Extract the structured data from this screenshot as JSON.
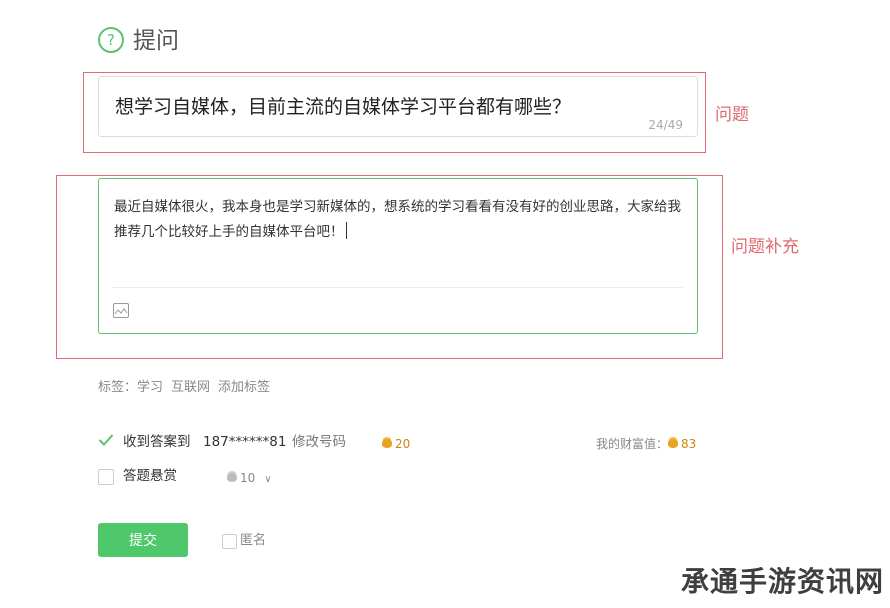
{
  "header": {
    "icon": "question-circle-icon",
    "icon_glyph": "?",
    "title": "提问"
  },
  "question": {
    "title_value": "想学习自媒体，目前主流的自媒体学习平台都有哪些？",
    "char_count": "24/49",
    "annotation": "问题"
  },
  "description": {
    "value": "最近自媒体很火，我本身也是学习新媒体的，想系统的学习看看有没有好的创业思路，大家给我推荐几个比较好上手的自媒体平台吧！",
    "annotation": "问题补充",
    "image_icon": "image-icon"
  },
  "tags": {
    "label": "标签：",
    "items": [
      "学习",
      "互联网"
    ],
    "add_label": "添加标签"
  },
  "notify": {
    "checked": true,
    "label": "收到答案到",
    "phone": "187******81",
    "change_label": "修改号码",
    "coin_value": "20"
  },
  "wealth": {
    "label": "我的财富值：",
    "value": "83"
  },
  "reward": {
    "checked": false,
    "label": "答题悬赏",
    "value": "10",
    "dropdown_glyph": "∨"
  },
  "submit": {
    "label": "提交"
  },
  "anonymous": {
    "checked": false,
    "label": "匿名"
  },
  "watermark": {
    "text": "承通手游资讯网"
  },
  "colors": {
    "accent_green": "#4fc76b",
    "annotation_red": "#e06a72",
    "coin_gold": "#e8a31f"
  }
}
